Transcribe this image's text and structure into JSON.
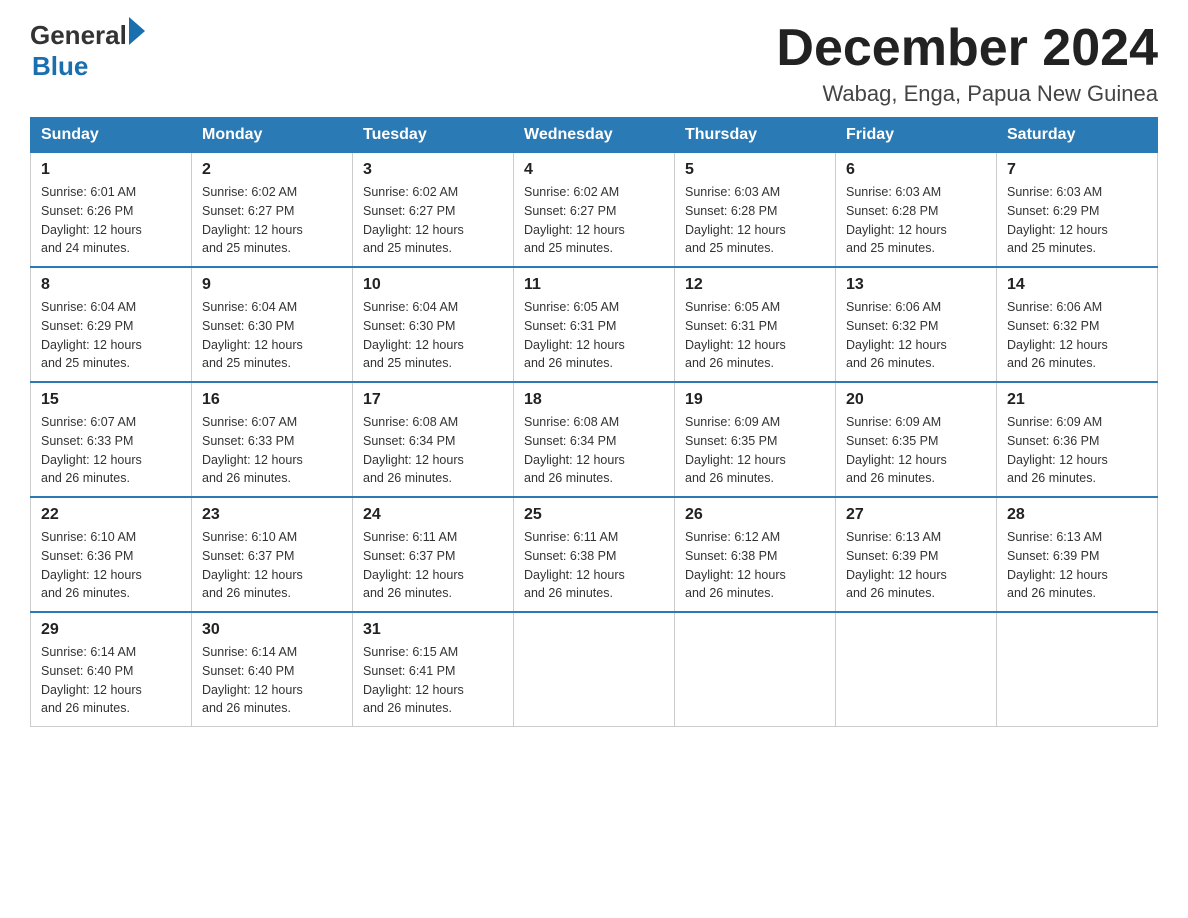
{
  "header": {
    "logo_general": "General",
    "logo_blue": "Blue",
    "title": "December 2024",
    "subtitle": "Wabag, Enga, Papua New Guinea"
  },
  "days_of_week": [
    "Sunday",
    "Monday",
    "Tuesday",
    "Wednesday",
    "Thursday",
    "Friday",
    "Saturday"
  ],
  "weeks": [
    [
      {
        "day": "1",
        "sunrise": "6:01 AM",
        "sunset": "6:26 PM",
        "daylight": "12 hours and 24 minutes."
      },
      {
        "day": "2",
        "sunrise": "6:02 AM",
        "sunset": "6:27 PM",
        "daylight": "12 hours and 25 minutes."
      },
      {
        "day": "3",
        "sunrise": "6:02 AM",
        "sunset": "6:27 PM",
        "daylight": "12 hours and 25 minutes."
      },
      {
        "day": "4",
        "sunrise": "6:02 AM",
        "sunset": "6:27 PM",
        "daylight": "12 hours and 25 minutes."
      },
      {
        "day": "5",
        "sunrise": "6:03 AM",
        "sunset": "6:28 PM",
        "daylight": "12 hours and 25 minutes."
      },
      {
        "day": "6",
        "sunrise": "6:03 AM",
        "sunset": "6:28 PM",
        "daylight": "12 hours and 25 minutes."
      },
      {
        "day": "7",
        "sunrise": "6:03 AM",
        "sunset": "6:29 PM",
        "daylight": "12 hours and 25 minutes."
      }
    ],
    [
      {
        "day": "8",
        "sunrise": "6:04 AM",
        "sunset": "6:29 PM",
        "daylight": "12 hours and 25 minutes."
      },
      {
        "day": "9",
        "sunrise": "6:04 AM",
        "sunset": "6:30 PM",
        "daylight": "12 hours and 25 minutes."
      },
      {
        "day": "10",
        "sunrise": "6:04 AM",
        "sunset": "6:30 PM",
        "daylight": "12 hours and 25 minutes."
      },
      {
        "day": "11",
        "sunrise": "6:05 AM",
        "sunset": "6:31 PM",
        "daylight": "12 hours and 26 minutes."
      },
      {
        "day": "12",
        "sunrise": "6:05 AM",
        "sunset": "6:31 PM",
        "daylight": "12 hours and 26 minutes."
      },
      {
        "day": "13",
        "sunrise": "6:06 AM",
        "sunset": "6:32 PM",
        "daylight": "12 hours and 26 minutes."
      },
      {
        "day": "14",
        "sunrise": "6:06 AM",
        "sunset": "6:32 PM",
        "daylight": "12 hours and 26 minutes."
      }
    ],
    [
      {
        "day": "15",
        "sunrise": "6:07 AM",
        "sunset": "6:33 PM",
        "daylight": "12 hours and 26 minutes."
      },
      {
        "day": "16",
        "sunrise": "6:07 AM",
        "sunset": "6:33 PM",
        "daylight": "12 hours and 26 minutes."
      },
      {
        "day": "17",
        "sunrise": "6:08 AM",
        "sunset": "6:34 PM",
        "daylight": "12 hours and 26 minutes."
      },
      {
        "day": "18",
        "sunrise": "6:08 AM",
        "sunset": "6:34 PM",
        "daylight": "12 hours and 26 minutes."
      },
      {
        "day": "19",
        "sunrise": "6:09 AM",
        "sunset": "6:35 PM",
        "daylight": "12 hours and 26 minutes."
      },
      {
        "day": "20",
        "sunrise": "6:09 AM",
        "sunset": "6:35 PM",
        "daylight": "12 hours and 26 minutes."
      },
      {
        "day": "21",
        "sunrise": "6:09 AM",
        "sunset": "6:36 PM",
        "daylight": "12 hours and 26 minutes."
      }
    ],
    [
      {
        "day": "22",
        "sunrise": "6:10 AM",
        "sunset": "6:36 PM",
        "daylight": "12 hours and 26 minutes."
      },
      {
        "day": "23",
        "sunrise": "6:10 AM",
        "sunset": "6:37 PM",
        "daylight": "12 hours and 26 minutes."
      },
      {
        "day": "24",
        "sunrise": "6:11 AM",
        "sunset": "6:37 PM",
        "daylight": "12 hours and 26 minutes."
      },
      {
        "day": "25",
        "sunrise": "6:11 AM",
        "sunset": "6:38 PM",
        "daylight": "12 hours and 26 minutes."
      },
      {
        "day": "26",
        "sunrise": "6:12 AM",
        "sunset": "6:38 PM",
        "daylight": "12 hours and 26 minutes."
      },
      {
        "day": "27",
        "sunrise": "6:13 AM",
        "sunset": "6:39 PM",
        "daylight": "12 hours and 26 minutes."
      },
      {
        "day": "28",
        "sunrise": "6:13 AM",
        "sunset": "6:39 PM",
        "daylight": "12 hours and 26 minutes."
      }
    ],
    [
      {
        "day": "29",
        "sunrise": "6:14 AM",
        "sunset": "6:40 PM",
        "daylight": "12 hours and 26 minutes."
      },
      {
        "day": "30",
        "sunrise": "6:14 AM",
        "sunset": "6:40 PM",
        "daylight": "12 hours and 26 minutes."
      },
      {
        "day": "31",
        "sunrise": "6:15 AM",
        "sunset": "6:41 PM",
        "daylight": "12 hours and 26 minutes."
      },
      null,
      null,
      null,
      null
    ]
  ],
  "labels": {
    "sunrise": "Sunrise:",
    "sunset": "Sunset:",
    "daylight": "Daylight:"
  },
  "colors": {
    "header_bg": "#2a7ab5",
    "border": "#ccc",
    "row_border": "#2a7ab5"
  }
}
